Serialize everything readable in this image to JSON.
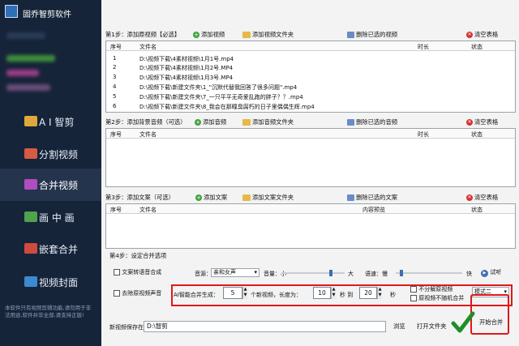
{
  "app": {
    "title": "固乔智剪软件"
  },
  "sidebar": {
    "items": [
      {
        "label": "A I 智剪",
        "icon": "ai-icon"
      },
      {
        "label": "分割视频",
        "icon": "split-icon"
      },
      {
        "label": "合并视频",
        "icon": "merge-icon",
        "active": true
      },
      {
        "label": "画 中 画",
        "icon": "pip-icon"
      },
      {
        "label": "嵌套合并",
        "icon": "nest-icon"
      },
      {
        "label": "视频封面",
        "icon": "cover-icon"
      }
    ],
    "footer": "本软件只有视频剪辑功能,请勿用于非法用途,软件并非全部,请支持正版!"
  },
  "step1": {
    "label": "第1步：添加原视频【必选】",
    "add": "添加视频",
    "add_folder": "添加视频文件夹",
    "delete": "删除已选的视频",
    "clear": "清空表格",
    "columns": [
      "序号",
      "文件名",
      "时长",
      "状态"
    ],
    "rows": [
      {
        "no": "1",
        "file": "D:\\视频下载\\4素材视频\\1月1号.mp4"
      },
      {
        "no": "2",
        "file": "D:\\视频下载\\4素材视频\\1月2号.MP4"
      },
      {
        "no": "3",
        "file": "D:\\视频下载\\4素材视频\\1月3号.MP4"
      },
      {
        "no": "4",
        "file": "D:\\视频下载\\新建文件夹\\1_\"沉默代替我回答了很多问题\".mp4"
      },
      {
        "no": "5",
        "file": "D:\\视频下载\\新建文件夹\\7_一只平平无奇爱乱跑的胖子？？.mp4"
      },
      {
        "no": "6",
        "file": "D:\\视频下载\\新建文件夹\\8_我会在那瞳臭腐朽的日子里偶偶生辉.mp4"
      }
    ]
  },
  "step2": {
    "label": "第2步：添加背景音频（可选）",
    "add": "添加音频",
    "add_folder": "添加音频文件夹",
    "delete": "删除已选的音频",
    "clear": "清空表格",
    "columns": [
      "序号",
      "文件名",
      "时长",
      "状态"
    ]
  },
  "step3": {
    "label": "第3步：添加文案（可选）",
    "add": "添加文案",
    "add_folder": "添加文案文件夹",
    "delete": "删除已选的文案",
    "clear": "清空表格",
    "columns": [
      "序号",
      "文件名",
      "内容预览",
      "状态"
    ]
  },
  "step4": {
    "label": "第4步：设定合并选项",
    "tts": "文案转语音合成",
    "voice_label": "音源：",
    "voice_value": "亲和女声",
    "volume_label": "音量：小",
    "volume_max": "大",
    "volume_level": 0.8,
    "speed_label": "语速：慢",
    "speed_max": "快",
    "speed_level": 0.07,
    "try": "试听",
    "remove_audio": "去除原视频声音",
    "ai_gen": "AI智能合并生成：",
    "ai_count": "5",
    "new_videos": "个新视频，长度为：",
    "len_min": "10",
    "sec_to": "秒 到",
    "len_max": "20",
    "sec": "秒",
    "no_split": "不分解原视频",
    "no_random": "原视频不随机合并",
    "mode": "模式二"
  },
  "output": {
    "save_label": "新视频保存在：",
    "path": "D:\\智剪",
    "browse": "浏览",
    "open_folder": "打开文件夹",
    "start": "开始合并"
  }
}
